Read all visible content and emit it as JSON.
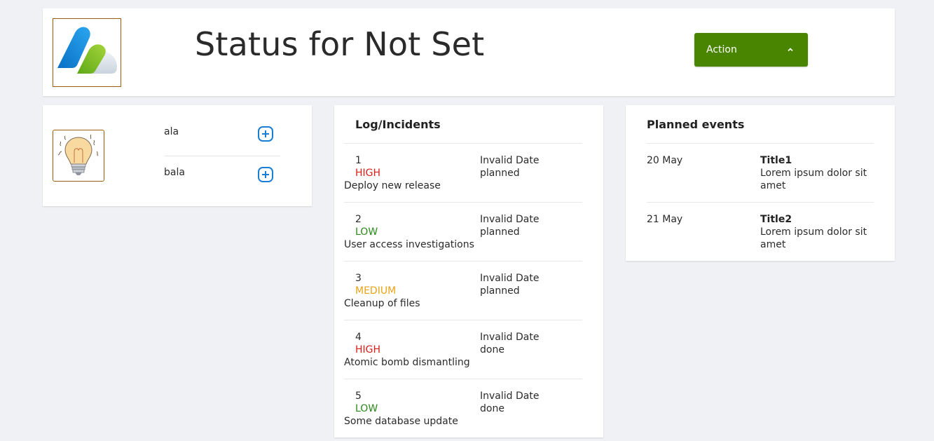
{
  "header": {
    "title": "Status for Not Set",
    "action_label": "Action",
    "logo_icon": "cloud-logo-icon",
    "action_color": "#4a8500"
  },
  "tags": {
    "icon": "lightbulb-icon",
    "items": [
      {
        "label": "ala"
      },
      {
        "label": "bala"
      }
    ]
  },
  "log": {
    "title": "Log/Incidents",
    "items": [
      {
        "id": "1",
        "severity": "HIGH",
        "description": "Deploy new release",
        "date": "Invalid Date",
        "status": "planned"
      },
      {
        "id": "2",
        "severity": "LOW",
        "description": "User access investigations",
        "date": "Invalid Date",
        "status": "planned"
      },
      {
        "id": "3",
        "severity": "MEDIUM",
        "description": "Cleanup of files",
        "date": "Invalid Date",
        "status": "planned"
      },
      {
        "id": "4",
        "severity": "HIGH",
        "description": "Atomic bomb dismantling",
        "date": "Invalid Date",
        "status": "done"
      },
      {
        "id": "5",
        "severity": "LOW",
        "description": "Some database update",
        "date": "Invalid Date",
        "status": "done"
      }
    ],
    "severity_colors": {
      "HIGH": "#d91e18",
      "LOW": "#2a8a1a",
      "MEDIUM": "#e8a317"
    }
  },
  "planned": {
    "title": "Planned events",
    "items": [
      {
        "date": "20 May",
        "title": "Title1",
        "description": "Lorem ipsum dolor sit amet"
      },
      {
        "date": "21 May",
        "title": "Title2",
        "description": "Lorem ipsum dolor sit amet"
      }
    ]
  }
}
